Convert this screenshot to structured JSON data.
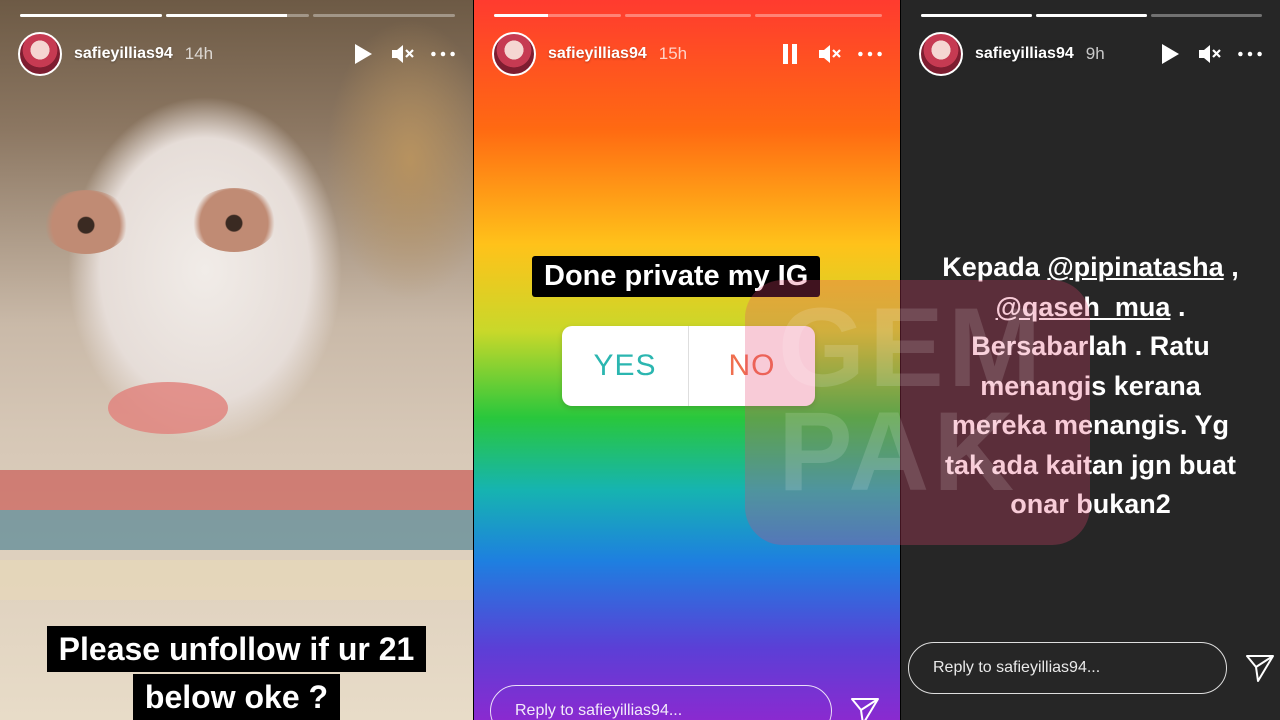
{
  "stories": [
    {
      "username": "safieyillias94",
      "time": "14h",
      "state": "paused",
      "progress": [
        1.0,
        0.85,
        0.0
      ],
      "caption_lines": [
        "Please unfollow if ur 21",
        "below oke ?"
      ]
    },
    {
      "username": "safieyillias94",
      "time": "15h",
      "state": "playing",
      "progress": [
        0.43,
        0.0,
        0.0
      ],
      "poll": {
        "question": "Done private my IG",
        "option_yes": "YES",
        "option_no": "NO"
      },
      "reply_placeholder": "Reply to safieyillias94..."
    },
    {
      "username": "safieyillias94",
      "time": "9h",
      "state": "paused",
      "progress": [
        1.0,
        1.0,
        0.0
      ],
      "message": {
        "line1_prefix": "Kepada ",
        "mention1": "@pipinatasha",
        "line1_suffix": " ,",
        "mention2": "@qaseh_mua",
        "line2_suffix": " .",
        "line3": "Bersabarlah . Ratu",
        "line4": "menangis kerana",
        "line5": "mereka menangis. Yg",
        "line6": "tak ada kaitan jgn buat",
        "line7": "onar bukan2"
      },
      "reply_placeholder": "Reply to safieyillias94..."
    }
  ],
  "watermark": {
    "line1": "GEM",
    "line2": "PAK"
  },
  "colors": {
    "poll_yes": "#2bb6b0",
    "poll_no": "#ef6f4f",
    "dark_bg": "#262626"
  }
}
